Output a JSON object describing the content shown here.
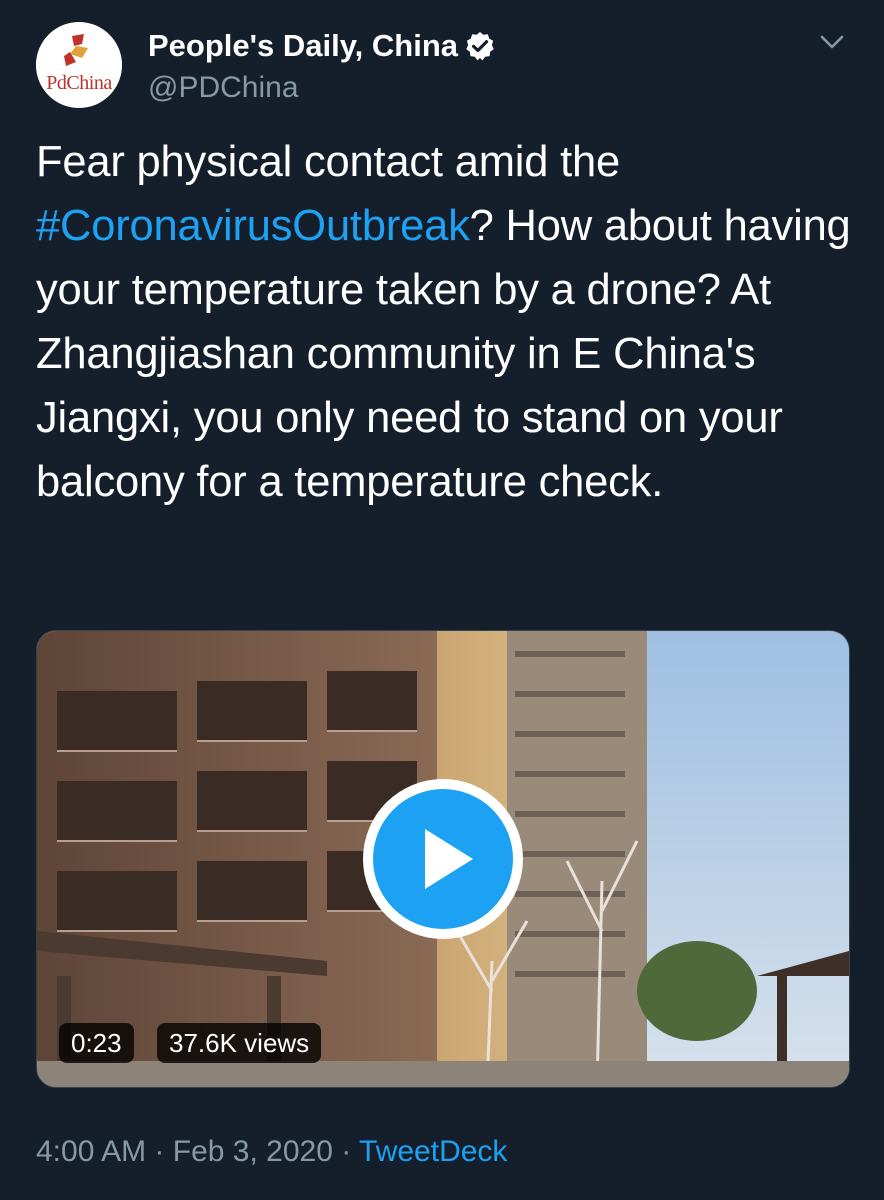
{
  "author": {
    "display_name": "People's Daily, China",
    "handle": "@PDChina",
    "avatar_label": "PdChina",
    "verified_icon": "verified-badge-icon"
  },
  "tweet": {
    "text_before": "Fear physical contact amid the ",
    "hashtag": "#CoronavirusOutbreak",
    "text_after": "? How about having your temperature taken by a drone? At Zhangjiashan community in E China's Jiangxi, you only need to stand on your balcony for a temperature check."
  },
  "media": {
    "type": "video",
    "duration": "0:23",
    "views": "37.6K views",
    "play_icon": "play-icon"
  },
  "meta": {
    "time": "4:00 AM",
    "separator": "·",
    "date": "Feb 3, 2020",
    "source": "TweetDeck"
  },
  "colors": {
    "background": "#151f2b",
    "link": "#1da1f2",
    "secondary_text": "#8899a6",
    "play_button": "#1da1f2"
  }
}
